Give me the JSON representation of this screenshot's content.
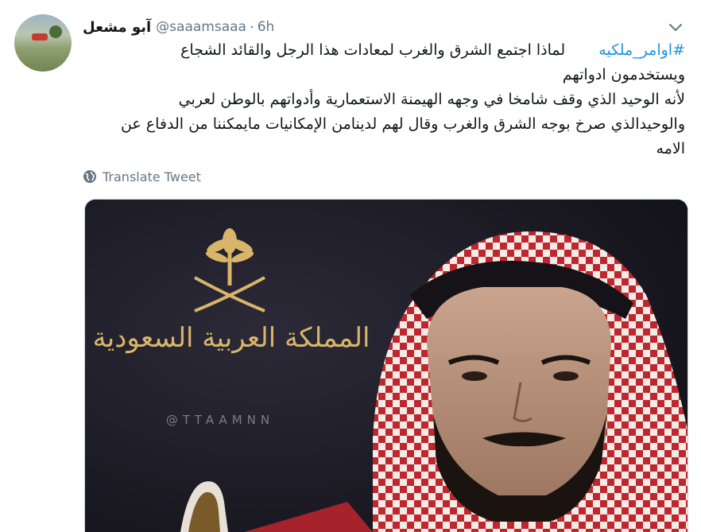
{
  "author": {
    "name": "آبو مشعل",
    "handle": "@saaamsaaa",
    "separator": "·",
    "time": "6h"
  },
  "tweet": {
    "hashtag": "#اوامر_ملكيه",
    "line1": "لماذا اجتمع الشرق والغرب لمعادات هذا الرجل والقائد الشجاع",
    "line2": "ويستخدمون ادواتهم",
    "line3": "لأنه الوحيد الذي وقف شامخا في وجهه الهيمنة الاستعمارية وأدواتهم بالوطن لعربي",
    "line4": "والوحيدالذي صرخ بوجه الشرق والغرب وقال لهم لدينامن الإمكانيات مايمكننا من الدفاع عن",
    "line5": "الامه"
  },
  "translate_label": "Translate Tweet",
  "media": {
    "emblem_text": "المملكة العربية السعودية",
    "watermark": "@TTAAMNN"
  },
  "colors": {
    "link": "#1b95e0",
    "muted": "#657786",
    "gold": "#d9b56a",
    "keffiyeh_red": "#c0262e"
  },
  "icons": {
    "caret": "chevron-down-icon",
    "translate": "globe-icon"
  }
}
